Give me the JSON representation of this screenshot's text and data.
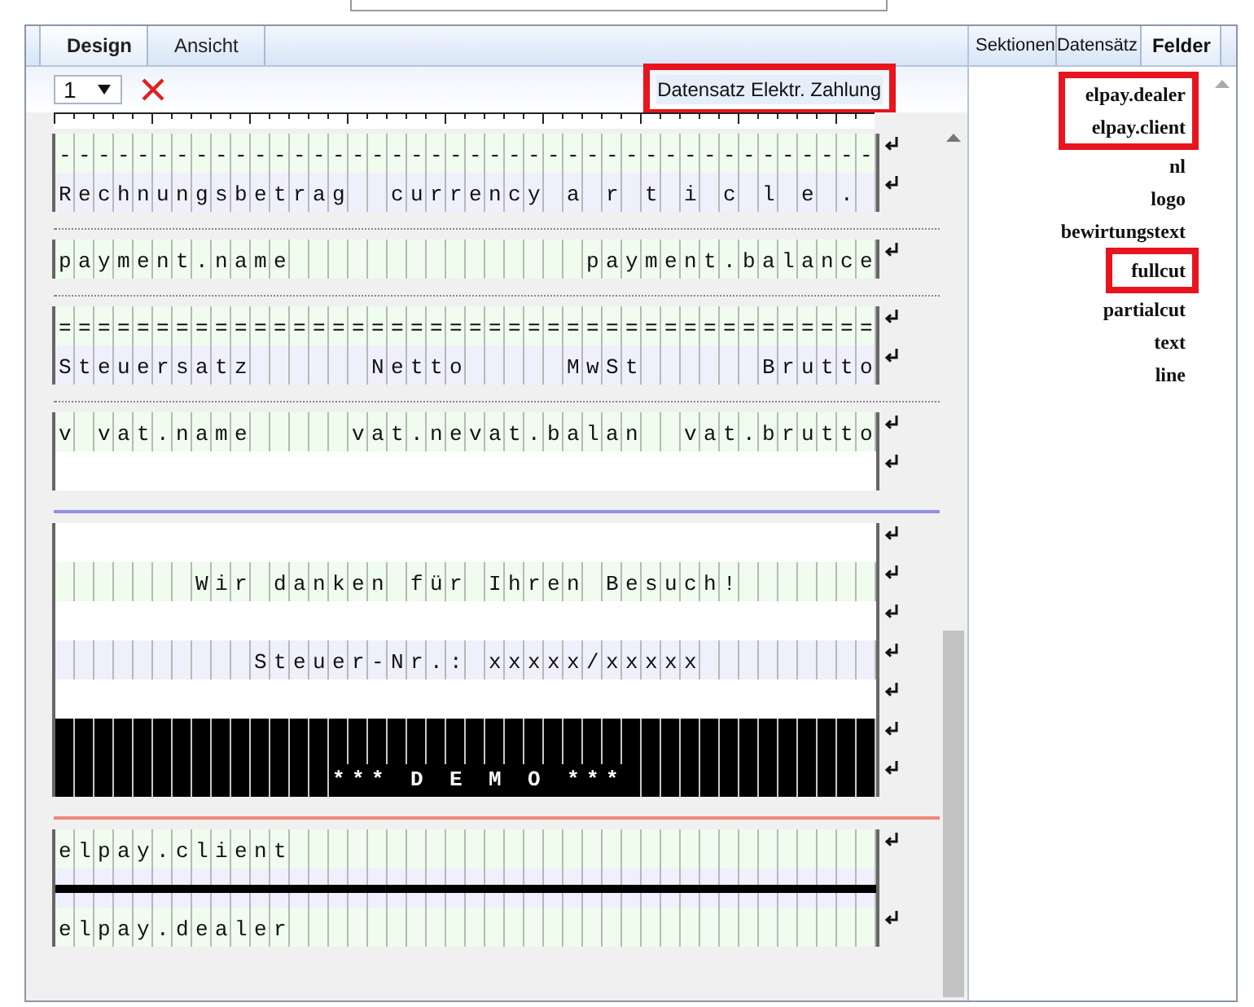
{
  "tabs": [
    {
      "label": "Design",
      "selected": true
    },
    {
      "label": "Ansicht",
      "selected": false
    }
  ],
  "panel_tabs": [
    {
      "label": "Sektionen",
      "selected": false
    },
    {
      "label": "Datensätz",
      "selected": false
    },
    {
      "label": "Felder",
      "selected": true
    }
  ],
  "toolbar": {
    "page_select": {
      "value": "1"
    },
    "record_button": {
      "label": "Datensatz Elektr. Zahlung",
      "highlighted": true
    }
  },
  "sections": [
    {
      "kind": "plain",
      "lines": [
        {
          "kind": "text",
          "color": "#effcee",
          "text": "------------------------------------------"
        },
        {
          "kind": "text",
          "color": "#f0f0fc",
          "text": "Rechnungsbetrag  currency a r t i c l e ."
        }
      ]
    },
    {
      "kind": "dotted",
      "lines": [
        {
          "kind": "text",
          "color": "#effcee",
          "text": "payment.name               payment.balance"
        }
      ]
    },
    {
      "kind": "dotted",
      "lines": [
        {
          "kind": "text",
          "color": "#effcee",
          "text": "=========================================="
        },
        {
          "kind": "text",
          "color": "#f0f0fc",
          "text": "Steuersatz      Netto     MwSt      Brutto"
        }
      ]
    },
    {
      "kind": "dotted",
      "lines": [
        {
          "kind": "text",
          "color": "#effcee",
          "text": "v vat.name     vat.nevat.balan  vat.brutto"
        },
        {
          "kind": "blank",
          "color": "#ffffff"
        }
      ]
    },
    {
      "kind": "solid",
      "color": "#8f8fe6",
      "lines": [
        {
          "kind": "blank",
          "color": "#ffffff"
        },
        {
          "kind": "text",
          "color": "#effcee",
          "centered": true,
          "text": "Wir danken für Ihren Besuch!"
        },
        {
          "kind": "blank",
          "color": "#ffffff"
        },
        {
          "kind": "text",
          "color": "#f0f0fc",
          "centered": true,
          "text": "Steuer-Nr.: xxxxx/xxxxx"
        },
        {
          "kind": "blank",
          "color": "#ffffff"
        },
        {
          "kind": "blank",
          "color": "#000000"
        },
        {
          "kind": "text",
          "color": "#000000",
          "centered": true,
          "text": "*** D E M O ***"
        }
      ]
    },
    {
      "kind": "solid",
      "color": "#f08878",
      "lines": [
        {
          "kind": "text",
          "color": "#effcee",
          "text": "elpay.client"
        },
        {
          "kind": "rule",
          "color": "#f0f0fc"
        },
        {
          "kind": "text",
          "color": "#effcee",
          "text": "elpay.dealer"
        }
      ]
    }
  ],
  "fields": [
    {
      "label": "elpay.dealer",
      "highlighted": true
    },
    {
      "label": "elpay.client",
      "highlighted": true
    },
    {
      "label": "nl",
      "highlighted": false
    },
    {
      "label": "logo",
      "highlighted": false
    },
    {
      "label": "bewirtungstext",
      "highlighted": false
    },
    {
      "label": "fullcut",
      "highlighted": true
    },
    {
      "label": "partialcut",
      "highlighted": false
    },
    {
      "label": "text",
      "highlighted": false
    },
    {
      "label": "line",
      "highlighted": false
    }
  ]
}
